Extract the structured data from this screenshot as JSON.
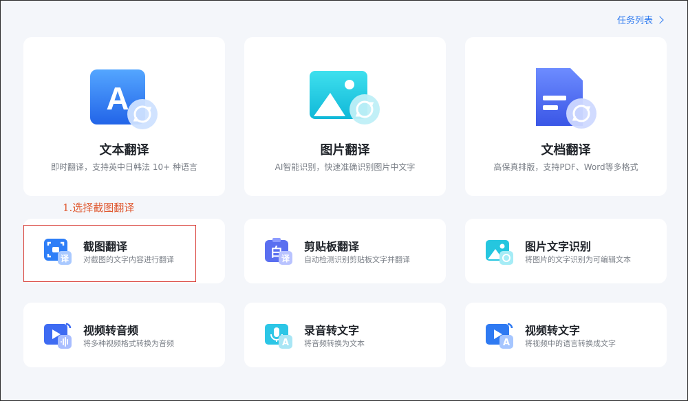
{
  "header": {
    "task_list_label": "任务列表"
  },
  "annotation": {
    "text": "1.选择截图翻译"
  },
  "big_cards": [
    {
      "title": "文本翻译",
      "desc": "即时翻译，支持英中日韩法 10+ 种语言",
      "icon": "text-translate-icon"
    },
    {
      "title": "图片翻译",
      "desc": "AI智能识别，快速准确识别图片中文字",
      "icon": "image-translate-icon"
    },
    {
      "title": "文档翻译",
      "desc": "高保真排版，支持PDF、Word等多格式",
      "icon": "document-translate-icon"
    }
  ],
  "small_cards": [
    {
      "title": "截图翻译",
      "desc": "对截图的文字内容进行翻译",
      "icon": "screenshot-translate-icon"
    },
    {
      "title": "剪贴板翻译",
      "desc": "自动检测识别剪贴板文字并翻译",
      "icon": "clipboard-translate-icon"
    },
    {
      "title": "图片文字识别",
      "desc": "将图片的文字识别为可编辑文本",
      "icon": "image-ocr-icon"
    },
    {
      "title": "视频转音频",
      "desc": "将多种视频格式转换为音频",
      "icon": "video-to-audio-icon"
    },
    {
      "title": "录音转文字",
      "desc": "将音频转换为文本",
      "icon": "audio-to-text-icon"
    },
    {
      "title": "视频转文字",
      "desc": "将视频中的语言转换成文字",
      "icon": "video-to-text-icon"
    }
  ],
  "colors": {
    "accent": "#2f7bf0",
    "annotation": "#e05a33",
    "highlight_border": "#d9413a",
    "background": "#f4f6fa"
  }
}
